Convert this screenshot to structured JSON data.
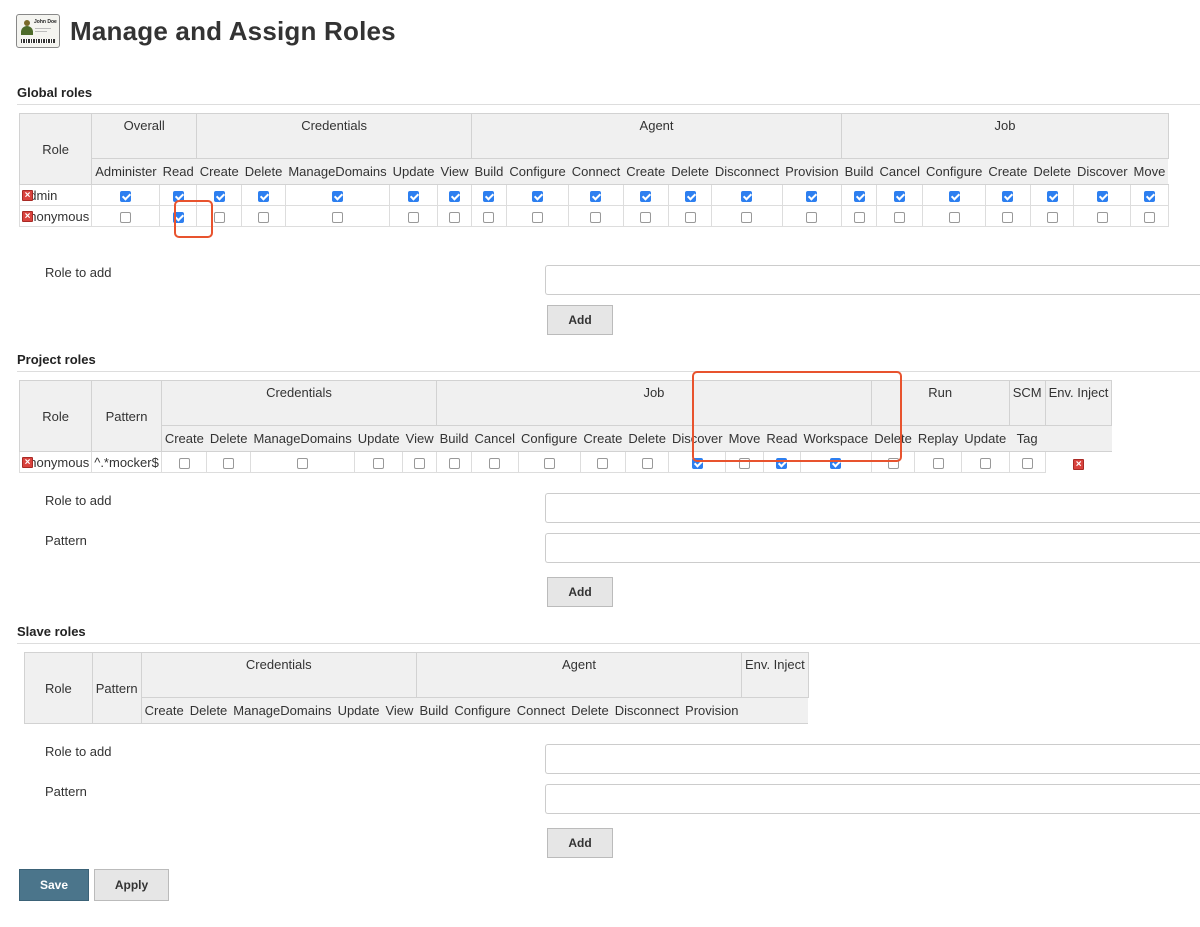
{
  "page": {
    "title": "Manage and Assign Roles",
    "badge_name": "John Doe"
  },
  "global": {
    "section_title": "Global roles",
    "role_header": "Role",
    "groups": [
      {
        "name": "Overall",
        "perms": [
          "Administer",
          "Read"
        ]
      },
      {
        "name": "Credentials",
        "perms": [
          "Create",
          "Delete",
          "ManageDomains",
          "Update",
          "View"
        ]
      },
      {
        "name": "Agent",
        "perms": [
          "Build",
          "Configure",
          "Connect",
          "Create",
          "Delete",
          "Disconnect",
          "Provision"
        ]
      },
      {
        "name": "Job",
        "perms": [
          "Build",
          "Cancel",
          "Configure",
          "Create",
          "Delete",
          "Discover",
          "Move"
        ]
      }
    ],
    "rows": [
      {
        "name": "admin",
        "checks": [
          true,
          true,
          true,
          true,
          true,
          true,
          true,
          true,
          true,
          true,
          true,
          true,
          true,
          true,
          true,
          true,
          true,
          true,
          true,
          true,
          true
        ]
      },
      {
        "name": "anonymous",
        "checks": [
          false,
          true,
          false,
          false,
          false,
          false,
          false,
          false,
          false,
          false,
          false,
          false,
          false,
          false,
          false,
          false,
          false,
          false,
          false,
          false,
          false
        ]
      }
    ],
    "role_to_add_label": "Role to add",
    "add_label": "Add"
  },
  "project": {
    "section_title": "Project roles",
    "role_header": "Role",
    "pattern_header": "Pattern",
    "groups": [
      {
        "name": "Credentials",
        "perms": [
          "Create",
          "Delete",
          "ManageDomains",
          "Update",
          "View"
        ]
      },
      {
        "name": "Job",
        "perms": [
          "Build",
          "Cancel",
          "Configure",
          "Create",
          "Delete",
          "Discover",
          "Move",
          "Read",
          "Workspace"
        ]
      },
      {
        "name": "Run",
        "perms": [
          "Delete",
          "Replay",
          "Update"
        ]
      },
      {
        "name": "SCM",
        "perms": [
          "Tag"
        ]
      },
      {
        "name": "Env. Inject",
        "perms": [
          ""
        ]
      }
    ],
    "rows": [
      {
        "name": "anonymous",
        "pattern": "^.*mocker$",
        "checks": [
          false,
          false,
          false,
          false,
          false,
          false,
          false,
          false,
          false,
          false,
          true,
          false,
          true,
          true,
          false,
          false,
          false,
          false
        ]
      }
    ],
    "role_to_add_label": "Role to add",
    "pattern_label": "Pattern",
    "add_label": "Add"
  },
  "slave": {
    "section_title": "Slave roles",
    "role_header": "Role",
    "pattern_header": "Pattern",
    "groups": [
      {
        "name": "Credentials",
        "perms": [
          "Create",
          "Delete",
          "ManageDomains",
          "Update",
          "View"
        ]
      },
      {
        "name": "Agent",
        "perms": [
          "Build",
          "Configure",
          "Connect",
          "Delete",
          "Disconnect",
          "Provision"
        ]
      },
      {
        "name": "Env. Inject",
        "perms": [
          ""
        ]
      }
    ],
    "role_to_add_label": "Role to add",
    "pattern_label": "Pattern",
    "add_label": "Add"
  },
  "footer": {
    "save_label": "Save",
    "apply_label": "Apply"
  },
  "colors": {
    "accent": "#4b758b",
    "highlight": "#e8532e",
    "checkbox": "#2d7ff0",
    "delete": "#d9433e"
  }
}
